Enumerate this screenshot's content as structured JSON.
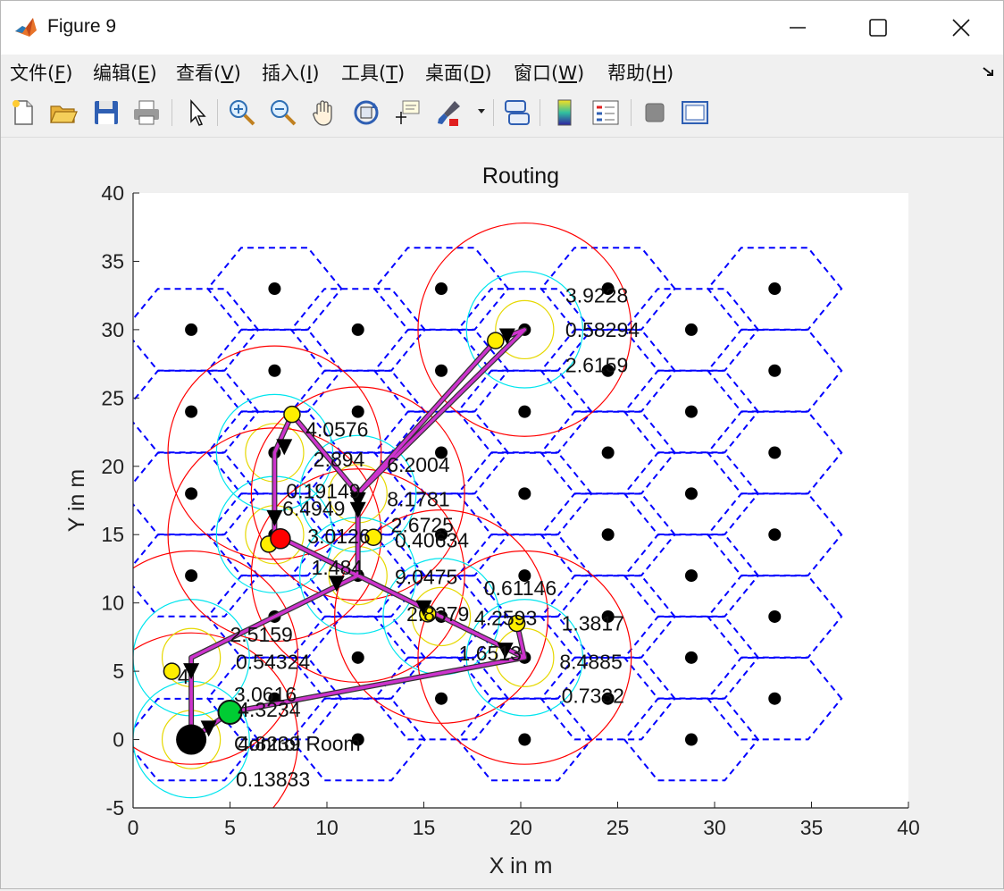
{
  "window": {
    "title": "Figure 9",
    "controls": {
      "minimize": "minimize",
      "maximize": "maximize",
      "close": "close"
    }
  },
  "menu": [
    {
      "pre": "文件(",
      "key": "F",
      "post": ")"
    },
    {
      "pre": "编辑(",
      "key": "E",
      "post": ")"
    },
    {
      "pre": "查看(",
      "key": "V",
      "post": ")"
    },
    {
      "pre": "插入(",
      "key": "I",
      "post": ")"
    },
    {
      "pre": "工具(",
      "key": "T",
      "post": ")"
    },
    {
      "pre": "桌面(",
      "key": "D",
      "post": ")"
    },
    {
      "pre": "窗口(",
      "key": "W",
      "post": ")"
    },
    {
      "pre": "帮助(",
      "key": "H",
      "post": ")"
    }
  ],
  "toolbar_icons": [
    "new-file-icon",
    "open-folder-icon",
    "save-icon",
    "print-icon",
    "pointer-icon",
    "zoom-in-icon",
    "zoom-out-icon",
    "pan-hand-icon",
    "rotate-3d-icon",
    "data-cursor-icon",
    "brush-icon",
    "link-plot-icon",
    "colorbar-icon",
    "legend-icon",
    "hide-plot-tools-icon",
    "show-plot-tools-icon"
  ],
  "plot": {
    "title": "Routing",
    "xlabel": "X in m",
    "ylabel": "Y in m",
    "xticks": [
      "0",
      "5",
      "10",
      "15",
      "20",
      "25",
      "30",
      "35",
      "40"
    ],
    "yticks": [
      "40",
      "35",
      "30",
      "25",
      "20",
      "15",
      "10",
      "5",
      "0",
      "-5"
    ],
    "colors": {
      "hex": "#0000ff",
      "route": "#cc33cc",
      "range_outer": "#ff0000",
      "range_mid": "#00e5ee",
      "range_inner": "#e6d800",
      "node": "#000000",
      "active_node": "#ffee00",
      "sink": "#00cc33",
      "cluster_head": "#ff0000"
    }
  },
  "chart_data": {
    "type": "scatter",
    "title": "Routing",
    "xlabel": "X in m",
    "ylabel": "Y in m",
    "xlim": [
      0,
      40
    ],
    "ylim": [
      -5,
      40
    ],
    "hex_centers": [
      [
        3,
        0
      ],
      [
        3,
        12
      ],
      [
        3,
        18
      ],
      [
        3,
        24
      ],
      [
        3,
        30
      ],
      [
        7.3,
        3
      ],
      [
        7.3,
        9
      ],
      [
        7.3,
        15
      ],
      [
        7.3,
        21
      ],
      [
        7.3,
        27
      ],
      [
        7.3,
        33
      ],
      [
        11.6,
        0
      ],
      [
        11.6,
        6
      ],
      [
        11.6,
        12
      ],
      [
        11.6,
        18
      ],
      [
        11.6,
        24
      ],
      [
        11.6,
        30
      ],
      [
        15.9,
        3
      ],
      [
        15.9,
        9
      ],
      [
        15.9,
        15
      ],
      [
        15.9,
        21
      ],
      [
        15.9,
        27
      ],
      [
        15.9,
        33
      ],
      [
        20.2,
        0
      ],
      [
        20.2,
        6
      ],
      [
        20.2,
        12
      ],
      [
        20.2,
        18
      ],
      [
        20.2,
        24
      ],
      [
        20.2,
        30
      ],
      [
        24.5,
        3
      ],
      [
        24.5,
        9
      ],
      [
        24.5,
        15
      ],
      [
        24.5,
        21
      ],
      [
        24.5,
        27
      ],
      [
        24.5,
        33
      ],
      [
        28.8,
        0
      ],
      [
        28.8,
        6
      ],
      [
        28.8,
        12
      ],
      [
        28.8,
        18
      ],
      [
        28.8,
        24
      ],
      [
        28.8,
        30
      ],
      [
        33.1,
        3
      ],
      [
        33.1,
        9
      ],
      [
        33.1,
        15
      ],
      [
        33.1,
        21
      ],
      [
        33.1,
        27
      ],
      [
        33.1,
        33
      ]
    ],
    "range_circles": [
      {
        "c": [
          3,
          0
        ],
        "r": [
          5.5,
          3
        ],
        "inner": 1.5
      },
      {
        "c": [
          3,
          6
        ],
        "r": [
          5.5,
          3
        ],
        "inner": 1.5
      },
      {
        "c": [
          7.3,
          21
        ],
        "r": [
          5.5,
          3
        ],
        "inner": 1.5
      },
      {
        "c": [
          7.3,
          15
        ],
        "r": [
          5.5,
          3
        ],
        "inner": 1.5
      },
      {
        "c": [
          11.6,
          18
        ],
        "r": [
          5.5,
          3
        ],
        "inner": 1.5
      },
      {
        "c": [
          11.6,
          12
        ],
        "r": [
          5.5,
          3
        ],
        "inner": 1.5
      },
      {
        "c": [
          15.9,
          9
        ],
        "r": [
          5.5,
          3
        ],
        "inner": 1.5
      },
      {
        "c": [
          20.2,
          6
        ],
        "r": [
          5.5,
          3
        ],
        "inner": 1.5
      },
      {
        "c": [
          20.2,
          30
        ],
        "r": [
          5.5,
          3
        ],
        "inner": 1.5
      }
    ],
    "route": [
      [
        3,
        0
      ],
      [
        3,
        6
      ],
      [
        11.6,
        12
      ],
      [
        7.3,
        15
      ],
      [
        7.3,
        21
      ],
      [
        8.2,
        23.8
      ],
      [
        11.6,
        18
      ],
      [
        20.2,
        30
      ],
      [
        18.7,
        29.2
      ],
      [
        11.6,
        18
      ],
      [
        11.6,
        15.7
      ],
      [
        11.6,
        12
      ],
      [
        15.9,
        9
      ],
      [
        20.2,
        6
      ],
      [
        19.8,
        8.5
      ],
      [
        20.2,
        6
      ],
      [
        5,
        2
      ],
      [
        3,
        0
      ]
    ],
    "arrow_heads": [
      [
        3,
        5
      ],
      [
        10.5,
        11.4
      ],
      [
        7.3,
        16.2
      ],
      [
        7.8,
        21.4
      ],
      [
        11.6,
        17.5
      ],
      [
        19.3,
        29.5
      ],
      [
        11.6,
        16.8
      ],
      [
        15,
        9.6
      ],
      [
        19.2,
        6.5
      ],
      [
        3.9,
        0.8
      ]
    ],
    "active_nodes": [
      [
        2,
        5
      ],
      [
        7,
        14.3
      ],
      [
        8.2,
        23.8
      ],
      [
        12.4,
        14.8
      ],
      [
        15.2,
        9.2
      ],
      [
        18.7,
        29.2
      ],
      [
        19.8,
        8.5
      ]
    ],
    "cluster_head": [
      7.6,
      14.7
    ],
    "sink": [
      5,
      2
    ],
    "base_station": [
      3,
      0
    ],
    "annotations": [
      {
        "t": "3.9228",
        "p": [
          22.3,
          32.5
        ]
      },
      {
        "t": "0.58294",
        "p": [
          22.3,
          30
        ]
      },
      {
        "t": "2.6159",
        "p": [
          22.3,
          27.4
        ]
      },
      {
        "t": "4.0576",
        "p": [
          8.9,
          22.7
        ]
      },
      {
        "t": "2.894",
        "p": [
          9.3,
          20.5
        ]
      },
      {
        "t": "6.2004",
        "p": [
          13.1,
          20.1
        ]
      },
      {
        "t": "0.19149",
        "p": [
          7.9,
          18.2
        ]
      },
      {
        "t": "6.4949",
        "p": [
          7.7,
          16.9
        ]
      },
      {
        "t": "8.1781",
        "p": [
          13.1,
          17.6
        ]
      },
      {
        "t": "2.6725",
        "p": [
          13.3,
          15.7
        ]
      },
      {
        "t": "0.40634",
        "p": [
          13.5,
          14.6
        ]
      },
      {
        "t": "3.0126",
        "p": [
          9.0,
          14.9
        ]
      },
      {
        "t": "1.484",
        "p": [
          9.2,
          12.6
        ]
      },
      {
        "t": "9.0475",
        "p": [
          13.5,
          11.9
        ]
      },
      {
        "t": "0.61146",
        "p": [
          18.1,
          11.1
        ]
      },
      {
        "t": "2.8379",
        "p": [
          14.1,
          9.2
        ]
      },
      {
        "t": "4.2593",
        "p": [
          17.6,
          8.9
        ]
      },
      {
        "t": "1.3817",
        "p": [
          22.1,
          8.5
        ]
      },
      {
        "t": "1.6513",
        "p": [
          16.8,
          6.3
        ]
      },
      {
        "t": "8.4885",
        "p": [
          22.0,
          5.7
        ]
      },
      {
        "t": "0.7332",
        "p": [
          22.1,
          3.2
        ]
      },
      {
        "t": "2.5159",
        "p": [
          5.0,
          7.7
        ]
      },
      {
        "t": "0.54324",
        "p": [
          5.3,
          5.7
        ]
      },
      {
        "t": "3.0616",
        "p": [
          5.2,
          3.3
        ]
      },
      {
        "t": "4.3234",
        "p": [
          5.4,
          2.2
        ]
      },
      {
        "t": "4",
        "p": [
          2.3,
          4.6
        ]
      },
      {
        "t": "0.13833",
        "p": [
          5.3,
          -2.9
        ]
      }
    ],
    "base_station_labels": [
      "Control Room",
      "4.8239"
    ],
    "base_station_label_pos": [
      [
        5.2,
        -0.3
      ],
      [
        5.4,
        -0.3
      ]
    ]
  }
}
